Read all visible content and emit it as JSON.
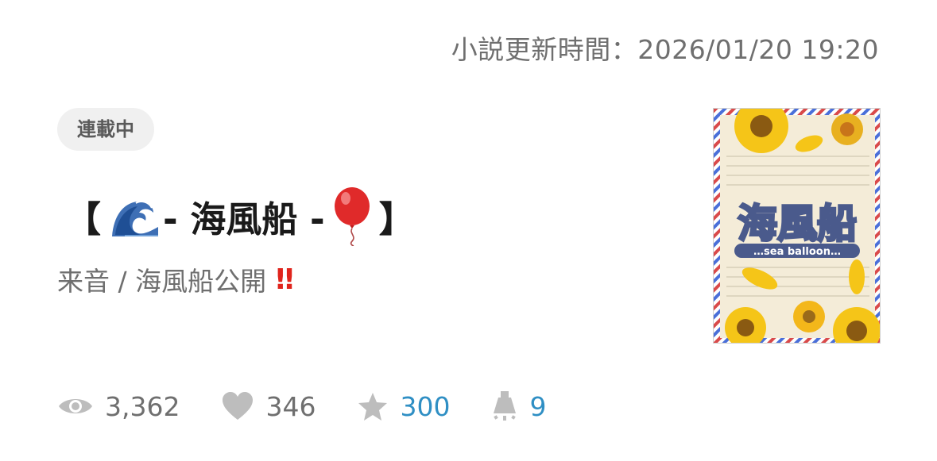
{
  "updated_text": "小説更新時間：2026/01/20 19:20",
  "status_badge": "連載中",
  "title": {
    "open_bracket": "【",
    "wave_emoji": "wave-emoji-icon",
    "dash_before": "- 海風船 -",
    "balloon_emoji": "balloon-emoji-icon",
    "close_bracket": "】"
  },
  "subtitle": {
    "text": "来音 / 海風船公開",
    "emphasis": "‼"
  },
  "cover": {
    "title": "海風船",
    "subtitle": "…sea balloon…"
  },
  "stats": {
    "views": "3,362",
    "likes": "346",
    "stars": "300",
    "spotlight": "9"
  },
  "colors": {
    "muted_text": "#6f6f6f",
    "link_blue": "#2f8fc4",
    "badge_bg": "#f0f0f0",
    "alert_red": "#e0241c",
    "icon_gray": "#bdbdbd"
  }
}
